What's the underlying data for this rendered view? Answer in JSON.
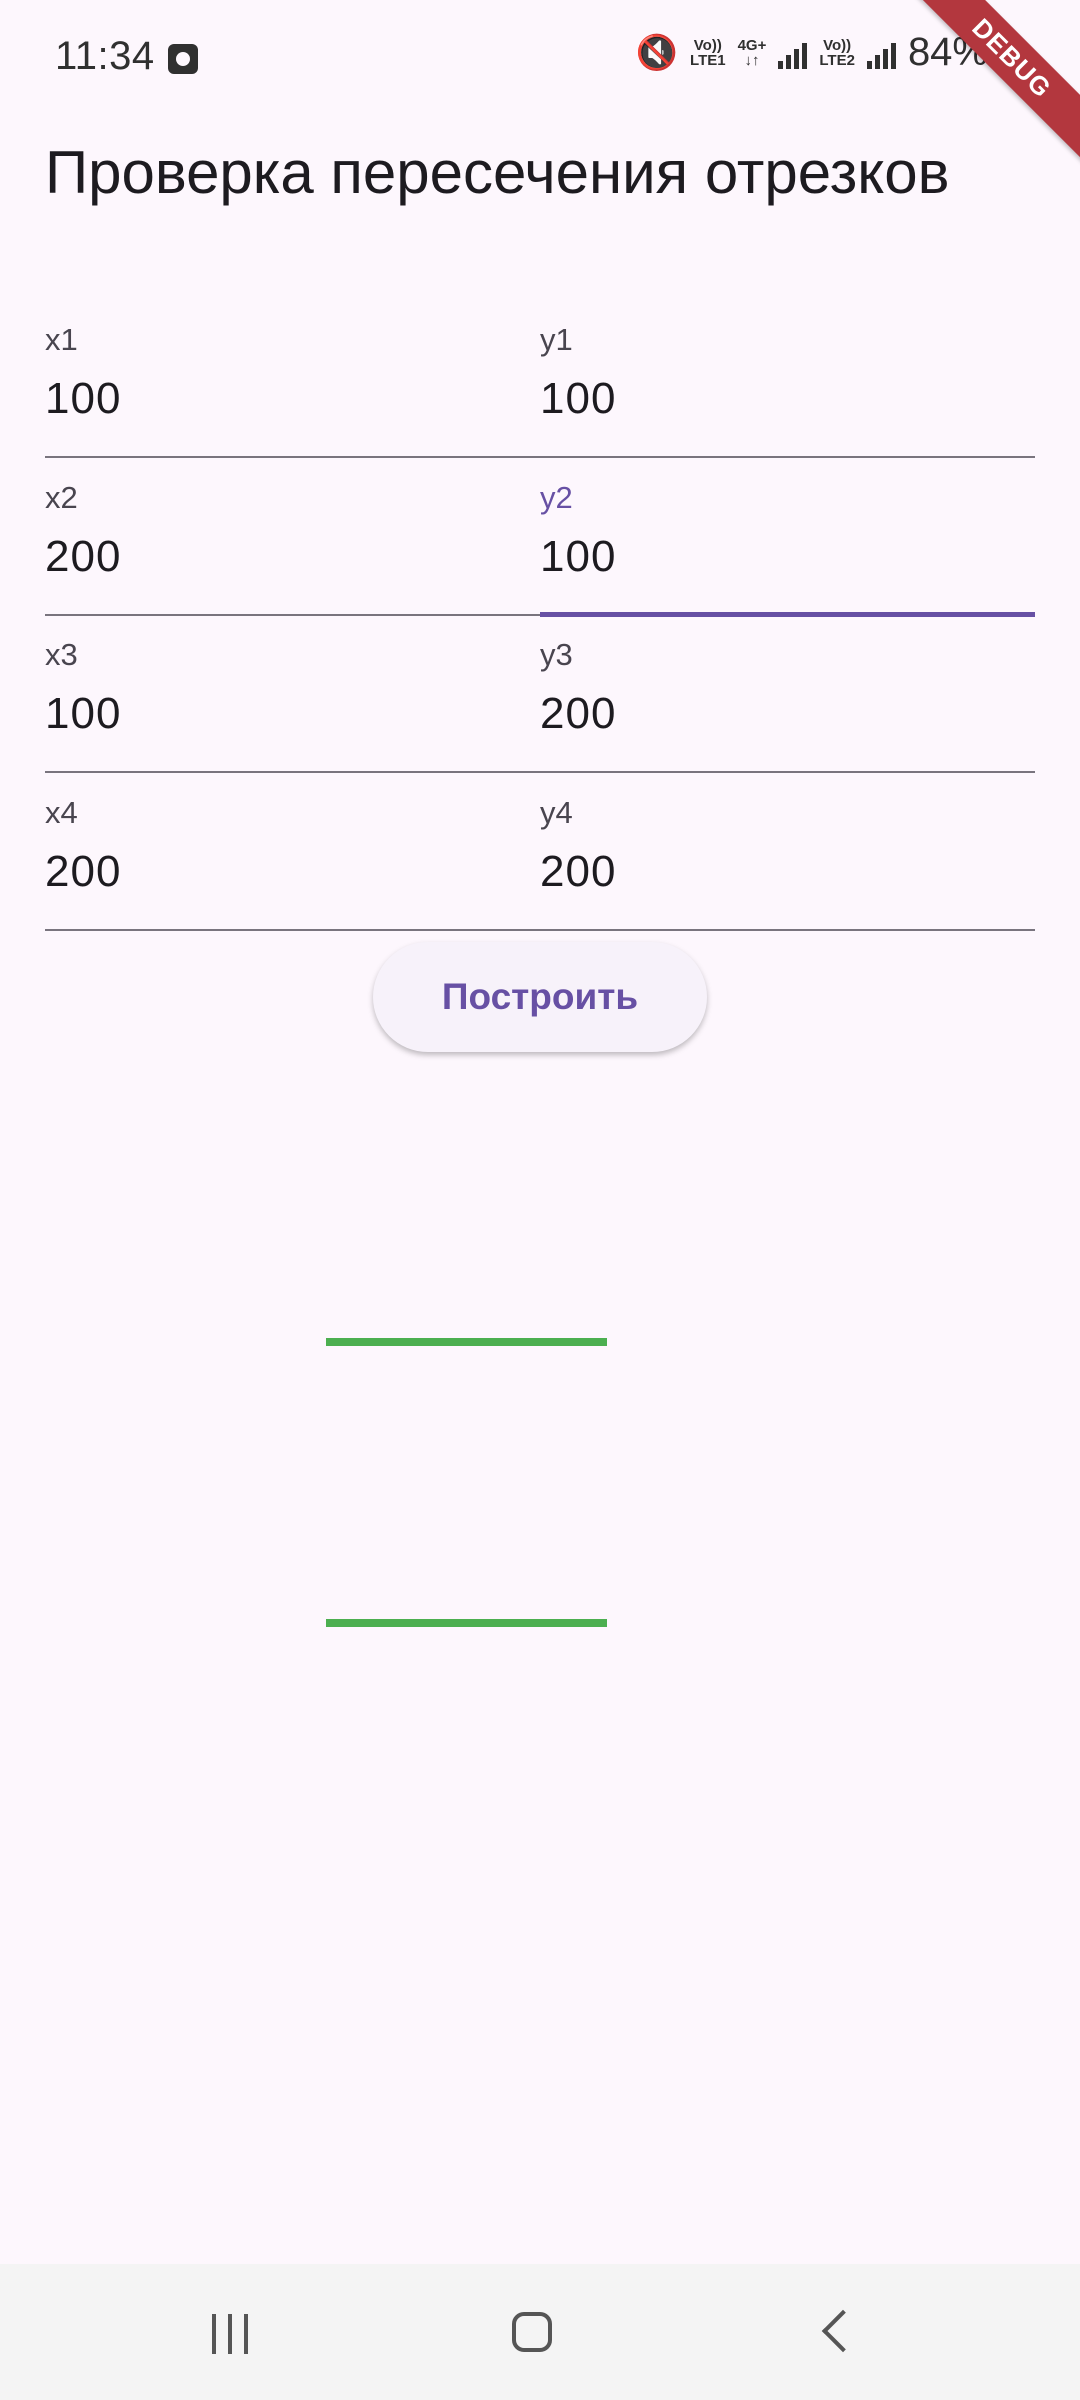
{
  "status_bar": {
    "time": "11:34",
    "volte1": "Vo))",
    "lte1": "LTE1",
    "net_type": "4G+",
    "volte2": "Vo))",
    "lte2": "LTE2",
    "battery": "84%"
  },
  "debug_banner": "DEBUG",
  "title": "Проверка пересечения отрезков",
  "fields": [
    {
      "label": "x1",
      "value": "100"
    },
    {
      "label": "y1",
      "value": "100"
    },
    {
      "label": "x2",
      "value": "200"
    },
    {
      "label": "y2",
      "value": "100"
    },
    {
      "label": "x3",
      "value": "100"
    },
    {
      "label": "y3",
      "value": "200"
    },
    {
      "label": "x4",
      "value": "200"
    },
    {
      "label": "y4",
      "value": "200"
    }
  ],
  "focused_field": "y2",
  "build_button_label": "Построить",
  "segment_color": "#4caf50",
  "accent_color": "#6750a4",
  "nav": {
    "recents_icon": "recents-icon",
    "home_icon": "home-icon",
    "back_icon": "back-icon"
  }
}
